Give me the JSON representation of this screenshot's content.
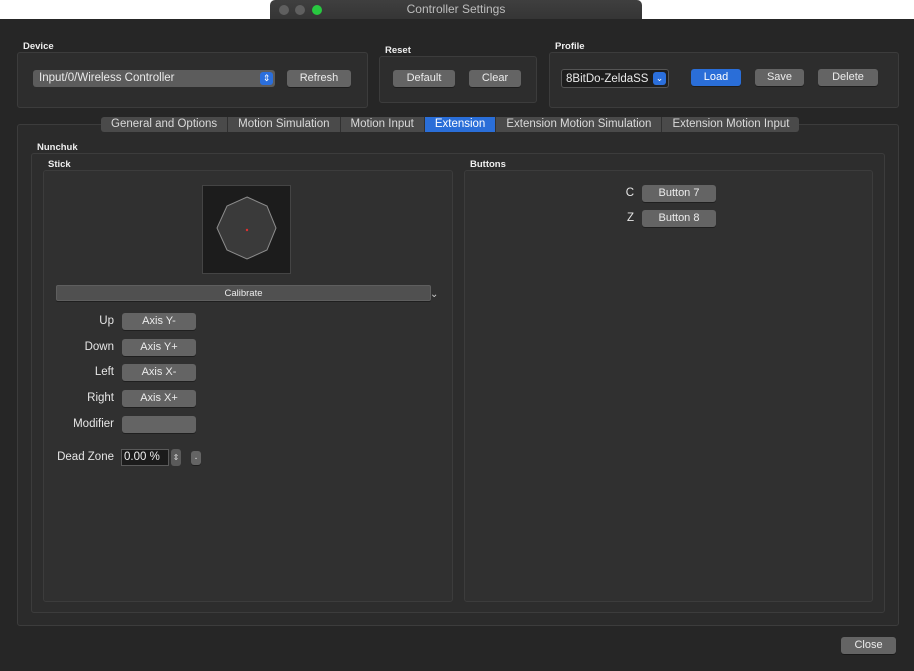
{
  "window": {
    "title": "Controller Settings"
  },
  "device": {
    "label": "Device",
    "selected": "Input/0/Wireless Controller",
    "refresh": "Refresh"
  },
  "reset": {
    "label": "Reset",
    "default": "Default",
    "clear": "Clear"
  },
  "profile": {
    "label": "Profile",
    "selected": "8BitDo-ZeldaSS",
    "load": "Load",
    "save": "Save",
    "delete": "Delete"
  },
  "tabs": [
    {
      "label": "General and Options"
    },
    {
      "label": "Motion Simulation"
    },
    {
      "label": "Motion Input"
    },
    {
      "label": "Extension"
    },
    {
      "label": "Extension Motion Simulation"
    },
    {
      "label": "Extension Motion Input"
    }
  ],
  "nunchuk": {
    "label": "Nunchuk",
    "stick": {
      "label": "Stick",
      "calibrate": "Calibrate",
      "up_label": "Up",
      "up_value": "Axis Y-",
      "down_label": "Down",
      "down_value": "Axis Y+",
      "left_label": "Left",
      "left_value": "Axis X-",
      "right_label": "Right",
      "right_value": "Axis X+",
      "modifier_label": "Modifier",
      "modifier_value": "",
      "deadzone_label": "Dead Zone",
      "deadzone_value": "0.00 %",
      "deadzone_extra": "."
    },
    "buttons": {
      "label": "Buttons",
      "c_label": "C",
      "c_value": "Button 7",
      "z_label": "Z",
      "z_value": "Button 8"
    }
  },
  "footer": {
    "close": "Close"
  },
  "colors": {
    "accent": "#2a6ed8",
    "background": "#262626",
    "close_light": "#ec5f57",
    "minimize_light": "#f5bd4f",
    "zoom_light": "#5ac33f"
  }
}
